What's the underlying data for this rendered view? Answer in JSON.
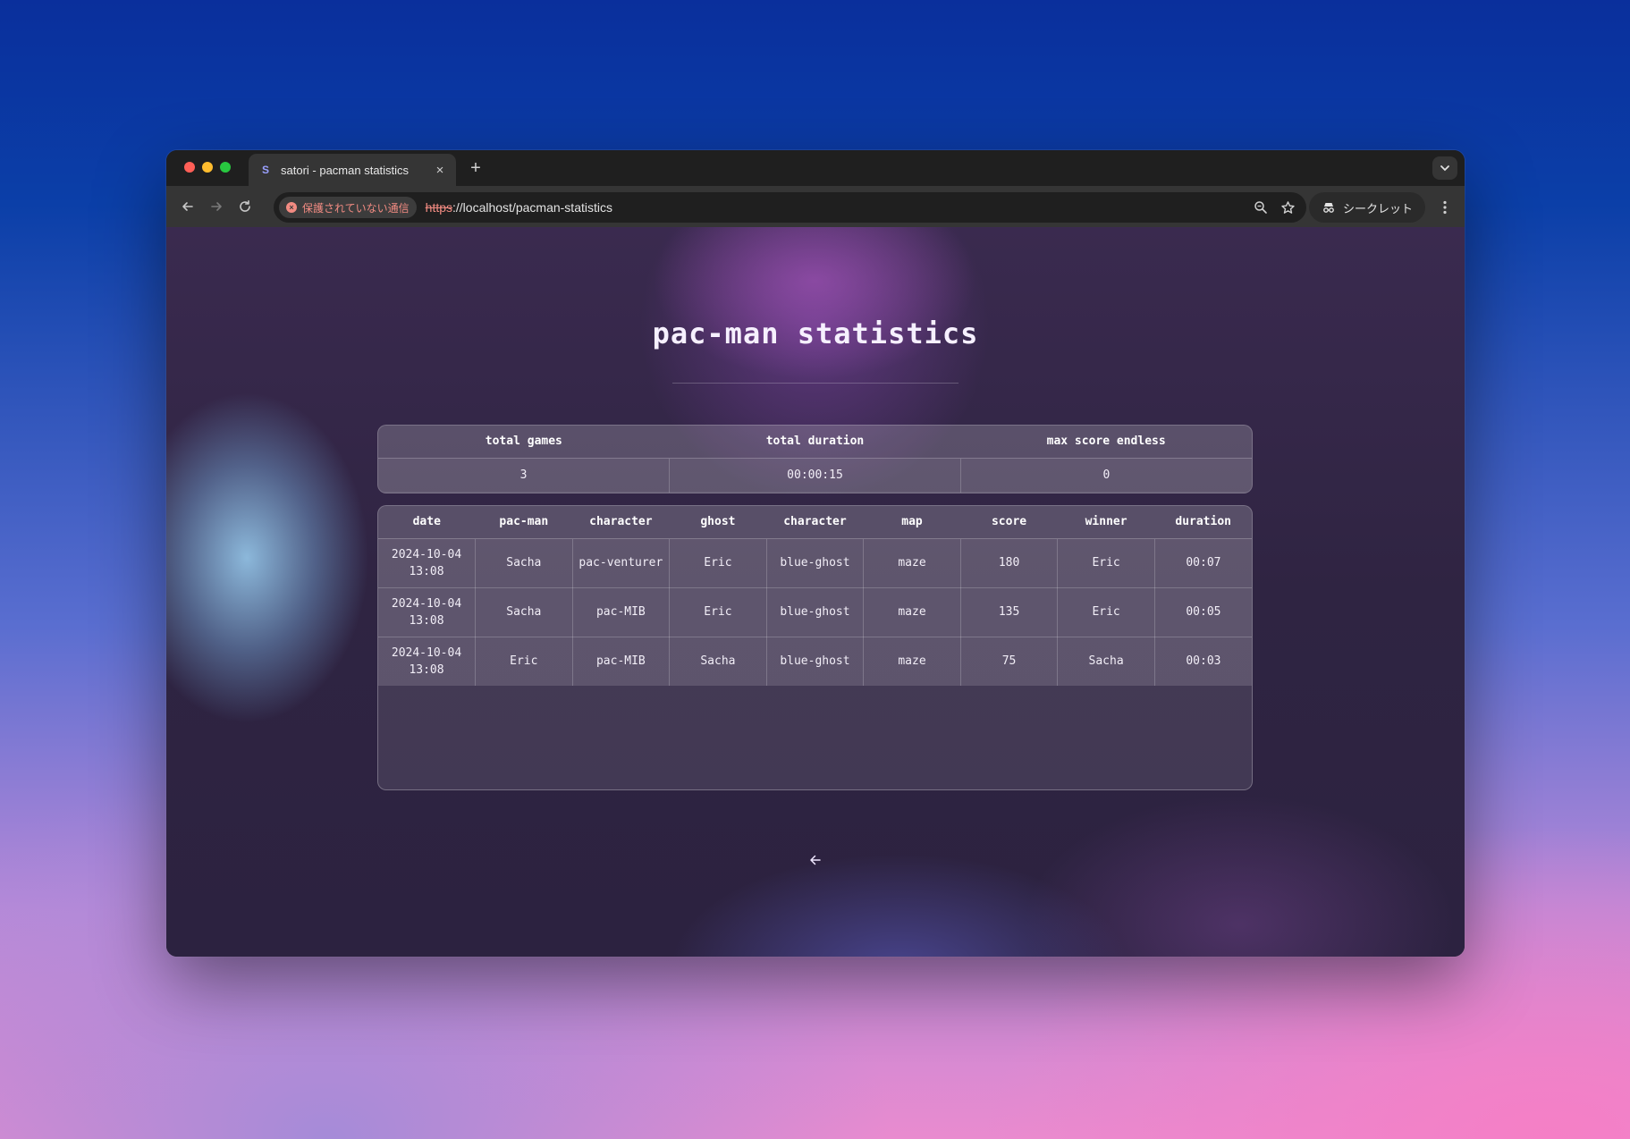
{
  "browser": {
    "tab_title": "satori - pacman statistics",
    "favicon_letter": "S",
    "tab_close": "×",
    "new_tab": "+",
    "security_label": "保護されていない通信",
    "url_scheme": "https",
    "url_rest": "://localhost/pacman-statistics",
    "incognito_label": "シークレット"
  },
  "page": {
    "title": "pac-man statistics"
  },
  "summary": {
    "headers": [
      "total games",
      "total duration",
      "max score endless"
    ],
    "values": [
      "3",
      "00:00:15",
      "0"
    ]
  },
  "games": {
    "headers": [
      "date",
      "pac-man",
      "character",
      "ghost",
      "character",
      "map",
      "score",
      "winner",
      "duration"
    ],
    "rows": [
      [
        "2024-10-04 13:08",
        "Sacha",
        "pac-venturer",
        "Eric",
        "blue-ghost",
        "maze",
        "180",
        "Eric",
        "00:07"
      ],
      [
        "2024-10-04 13:08",
        "Sacha",
        "pac-MIB",
        "Eric",
        "blue-ghost",
        "maze",
        "135",
        "Eric",
        "00:05"
      ],
      [
        "2024-10-04 13:08",
        "Eric",
        "pac-MIB",
        "Sacha",
        "blue-ghost",
        "maze",
        "75",
        "Sacha",
        "00:03"
      ]
    ]
  },
  "icons": {
    "back": "arrow-left-icon",
    "forward": "arrow-right-icon",
    "reload": "reload-icon",
    "zoom": "zoom-icon",
    "bookmark": "star-icon",
    "menu": "kebab-menu-icon",
    "incognito": "incognito-icon",
    "page_back": "arrow-left-icon"
  }
}
